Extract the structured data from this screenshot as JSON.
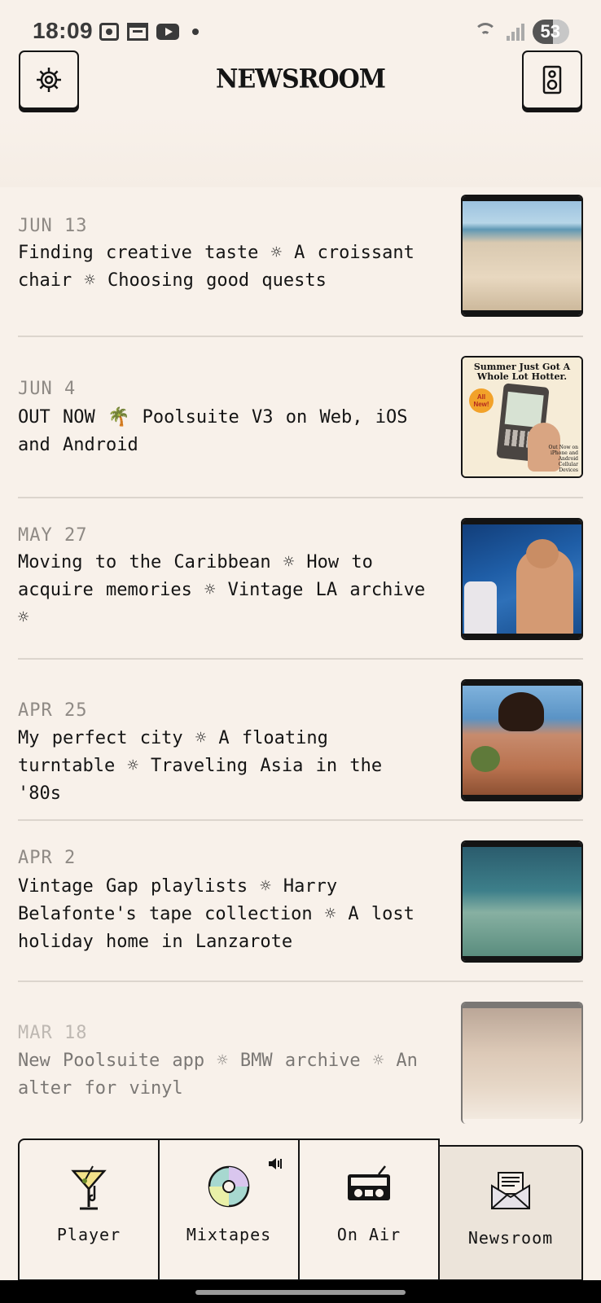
{
  "status_bar": {
    "time": "18:09",
    "battery": "53"
  },
  "header": {
    "title": "NEWSROOM",
    "settings_icon": "gear-icon",
    "speaker_icon": "speaker-icon"
  },
  "articles": [
    {
      "date": "JUN 13",
      "headline": "Finding creative taste ☼ A croissant chair ☼ Choosing good quests"
    },
    {
      "date": "JUN 4",
      "headline": "OUT NOW 🌴 Poolsuite V3 on Web, iOS and Android"
    },
    {
      "date": "MAY 27",
      "headline": "Moving to the Caribbean ☼ How to acquire memories ☼ Vintage LA archive ☼"
    },
    {
      "date": "APR 25",
      "headline": "My perfect city ☼ A floating turntable ☼ Traveling Asia in the '80s"
    },
    {
      "date": "APR 2",
      "headline": "Vintage Gap playlists ☼ Harry Belafonte's tape collection ☼  A lost holiday home in Lanzarote"
    },
    {
      "date": "MAR 18",
      "headline": "New Poolsuite app ☼ BMW archive ☼ An alter for vinyl"
    }
  ],
  "promo_card": {
    "heading": "Summer Just Got A Whole Lot Hotter.",
    "badge": "All New!",
    "footer": "Out Now on iPhone and Android Cellular Devices"
  },
  "tabs": [
    {
      "label": "Player"
    },
    {
      "label": "Mixtapes"
    },
    {
      "label": "On Air"
    },
    {
      "label": "Newsroom"
    }
  ]
}
